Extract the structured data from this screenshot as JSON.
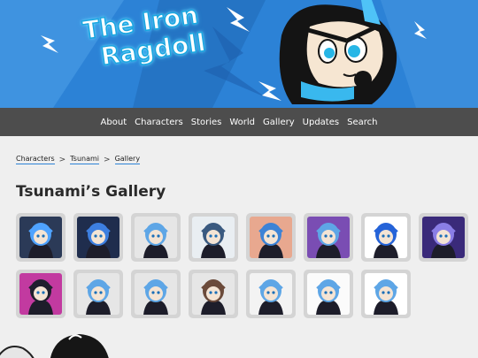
{
  "site": {
    "title_line1": "The Iron",
    "title_line2": "Ragdoll"
  },
  "nav": {
    "items": [
      "About",
      "Characters",
      "Stories",
      "World",
      "Gallery",
      "Updates",
      "Search"
    ]
  },
  "breadcrumb": {
    "items": [
      "Characters",
      "Tsunami",
      "Gallery"
    ],
    "separator": ">"
  },
  "page": {
    "heading": "Tsunami’s Gallery"
  },
  "gallery": {
    "thumbnails": [
      {
        "bg": "#2b3a57",
        "accent": "#4fa3ff"
      },
      {
        "bg": "#1f2d4d",
        "accent": "#3d7fe0"
      },
      {
        "bg": "#e6e6e6",
        "accent": "#5ea6e6"
      },
      {
        "bg": "#e9eef2",
        "accent": "#3a5a80"
      },
      {
        "bg": "#e8a88f",
        "accent": "#3d83d6"
      },
      {
        "bg": "#7a4db3",
        "accent": "#5ea6e6"
      },
      {
        "bg": "#ffffff",
        "accent": "#2563d8"
      },
      {
        "bg": "#3a2a7a",
        "accent": "#8a7ee6"
      },
      {
        "bg": "#c23aa0",
        "accent": "#1f1f2e"
      },
      {
        "bg": "#e6e6e6",
        "accent": "#5ea6e6"
      },
      {
        "bg": "#e6e6e6",
        "accent": "#5ea6e6"
      },
      {
        "bg": "#e6e6e6",
        "accent": "#6b4a3a"
      },
      {
        "bg": "#f3f3f3",
        "accent": "#5ea6e6"
      },
      {
        "bg": "#fbfbfb",
        "accent": "#5ea6e6"
      },
      {
        "bg": "#ffffff",
        "accent": "#5ea6e6"
      }
    ]
  },
  "colors": {
    "banner": "#2c82d6",
    "nav": "#4d4d4d",
    "accent_underline": "#2c82d6",
    "page_bg": "#efefef"
  }
}
